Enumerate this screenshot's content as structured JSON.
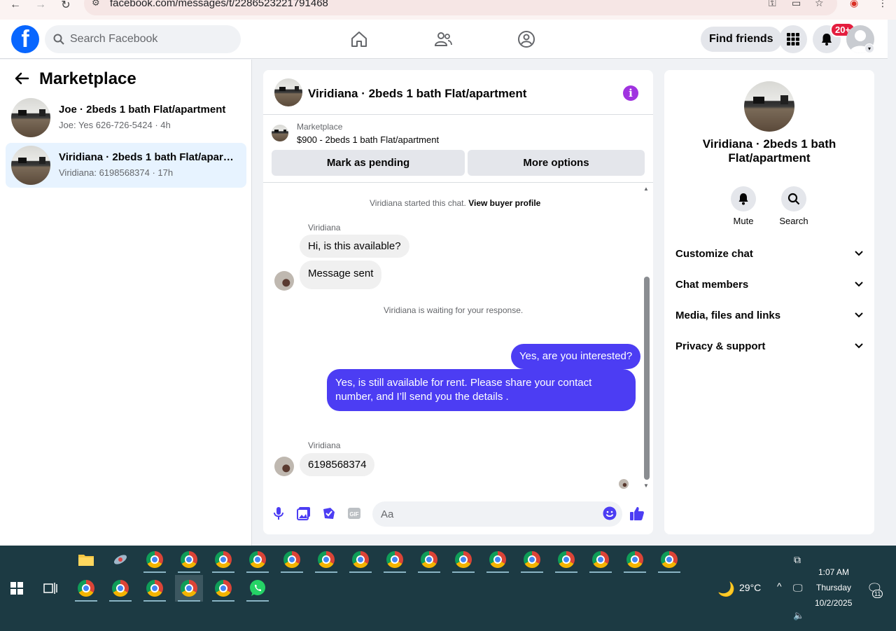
{
  "browser": {
    "url": "facebook.com/messages/t/2286523221791468"
  },
  "header": {
    "search_placeholder": "Search Facebook",
    "find_friends": "Find friends",
    "notification_badge": "20+"
  },
  "left": {
    "title": "Marketplace",
    "conversations": [
      {
        "title": "Joe · 2beds 1 bath Flat/apartment",
        "subtitle": "Joe: Yes 626-726-5424 · 4h"
      },
      {
        "title": "Viridiana · 2beds 1 bath Flat/apartment",
        "subtitle": "Viridiana: 6198568374 · 17h"
      }
    ]
  },
  "chat": {
    "title": "Viridiana · 2beds 1 bath Flat/apartment",
    "listing_label": "Marketplace",
    "listing_price": "$900 - 2beds 1 bath Flat/apartment",
    "mark_pending": "Mark as pending",
    "more_options": "More options",
    "started_text": "Viridiana started this chat.",
    "view_buyer_profile": "View buyer profile",
    "sender_1": "Viridiana",
    "msg_1": "Hi, is this available?",
    "msg_2": "Message sent",
    "waiting_text": "Viridiana is waiting for your response.",
    "out_1": "Yes, are you interested?",
    "out_2": "Yes, is still available for rent. Please share your contact number, and I’ll send you the details .",
    "sender_2": "Viridiana",
    "msg_3": "6198568374",
    "composer_placeholder": "Aa"
  },
  "info": {
    "name": "Viridiana · 2beds 1 bath Flat/apartment",
    "mute": "Mute",
    "search": "Search",
    "rows": [
      "Customize chat",
      "Chat members",
      "Media, files and links",
      "Privacy & support"
    ]
  },
  "taskbar": {
    "weather": "29°C",
    "time": "1:07 AM",
    "day": "Thursday",
    "date": "10/2/2025",
    "notif_count": "11"
  },
  "colors": {
    "accent": "#4c3df3",
    "facebook_blue": "#0866ff",
    "info_purple": "#a033e0",
    "taskbar": "#1c3a43"
  }
}
